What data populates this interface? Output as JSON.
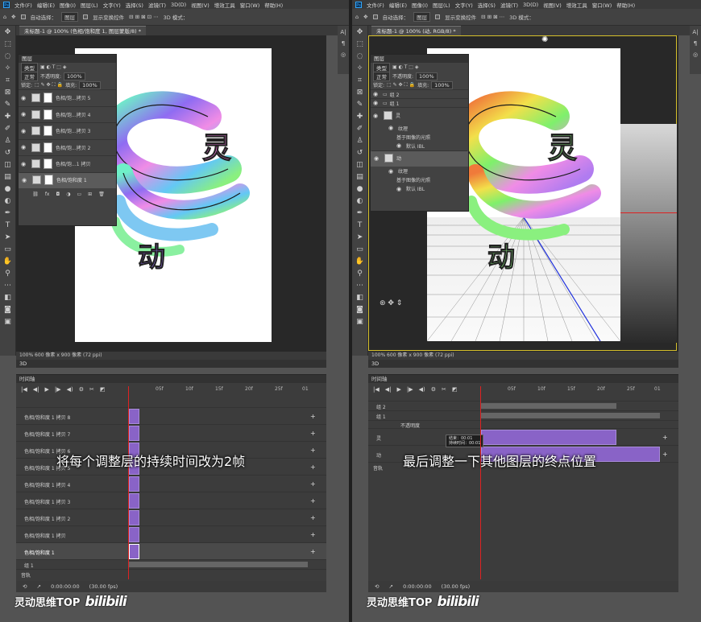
{
  "menu": [
    "文件(F)",
    "编辑(E)",
    "图像(I)",
    "图层(L)",
    "文字(Y)",
    "选择(S)",
    "滤镜(T)",
    "3D(D)",
    "视图(V)",
    "增效工具",
    "窗口(W)",
    "帮助(H)"
  ],
  "options": {
    "auto_select_label": "自动选择：",
    "auto_select_value": "图层",
    "show_transform": "显示变换控件",
    "mode_3d": "3D 模式："
  },
  "left": {
    "doc_tab": "未标题-1 @ 100% (色相/饱和度 1, 图层蒙版/8) *",
    "status": "100%    600 像素 x 900 像素 (72 ppi)",
    "layers_panel": {
      "title": "图层",
      "kind": "类型",
      "blend": "正常",
      "opacity_label": "不透明度:",
      "opacity": "100%",
      "lock_label": "锁定:",
      "fill_label": "填充:",
      "fill": "100%",
      "layers": [
        "色相/饱...拷贝 5",
        "色相/饱...拷贝 4",
        "色相/饱...拷贝 3",
        "色相/饱...拷贝 2",
        "色相/饱...1 拷贝",
        "色相/饱和度 1"
      ]
    },
    "canvas_text": {
      "top": "灵",
      "bottom": "动"
    },
    "panel_3d": "3D",
    "timeline": {
      "title": "时间轴",
      "ruler": [
        "05f",
        "10f",
        "15f",
        "20f",
        "25f",
        "01"
      ],
      "rows": [
        "色相/饱和度 1 拷贝 8",
        "色相/饱和度 1 拷贝 7",
        "色相/饱和度 1 拷贝 6",
        "色相/饱和度 1 拷贝 5",
        "色相/饱和度 1 拷贝 4",
        "色相/饱和度 1 拷贝 3",
        "色相/饱和度 1 拷贝 2",
        "色相/饱和度 1 拷贝",
        "色相/饱和度 1"
      ],
      "group": "组 1",
      "audio": "音轨",
      "time": "0:00:00:00",
      "fps": "(30.00 fps)"
    },
    "subtitle": "将每个调整层的持续时间改为2帧"
  },
  "right": {
    "doc_tab": "未标题-1 @ 100% (动, RGB/8) *",
    "status": "100%    600 像素 x 900 像素 (72 ppi)",
    "layers_panel": {
      "title": "图层",
      "kind": "类型",
      "blend": "正常",
      "opacity_label": "不透明度:",
      "opacity": "100%",
      "lock_label": "锁定:",
      "fill_label": "填充:",
      "fill": "100%",
      "rows": [
        "组 2",
        "组 1",
        "灵",
        "纹理",
        "基于图像的光照",
        "默认 IBL",
        "动",
        "纹理",
        "基于图像的光照",
        "默认 IBL"
      ]
    },
    "canvas_text": {
      "top": "灵",
      "bottom": "动"
    },
    "panel_3d": "3D",
    "timeline": {
      "title": "时间轴",
      "ruler": [
        "05f",
        "10f",
        "15f",
        "20f",
        "25f",
        "01"
      ],
      "rows": [
        "组 2",
        "组 1",
        "不透明度",
        "灵",
        "动",
        "音轨"
      ],
      "tooltip": [
        "结束：00:01",
        "持续时间：00:01"
      ],
      "time": "0:00:00:00",
      "fps": "(30.00 fps)"
    },
    "subtitle": "最后调整一下其他图层的终点位置"
  },
  "watermark": {
    "text": "灵动思维TOP",
    "logo": "bilibili"
  },
  "colors": {
    "clip": "#8963c7",
    "playhead": "#d22222",
    "accent_frame": "#d6c02b"
  }
}
